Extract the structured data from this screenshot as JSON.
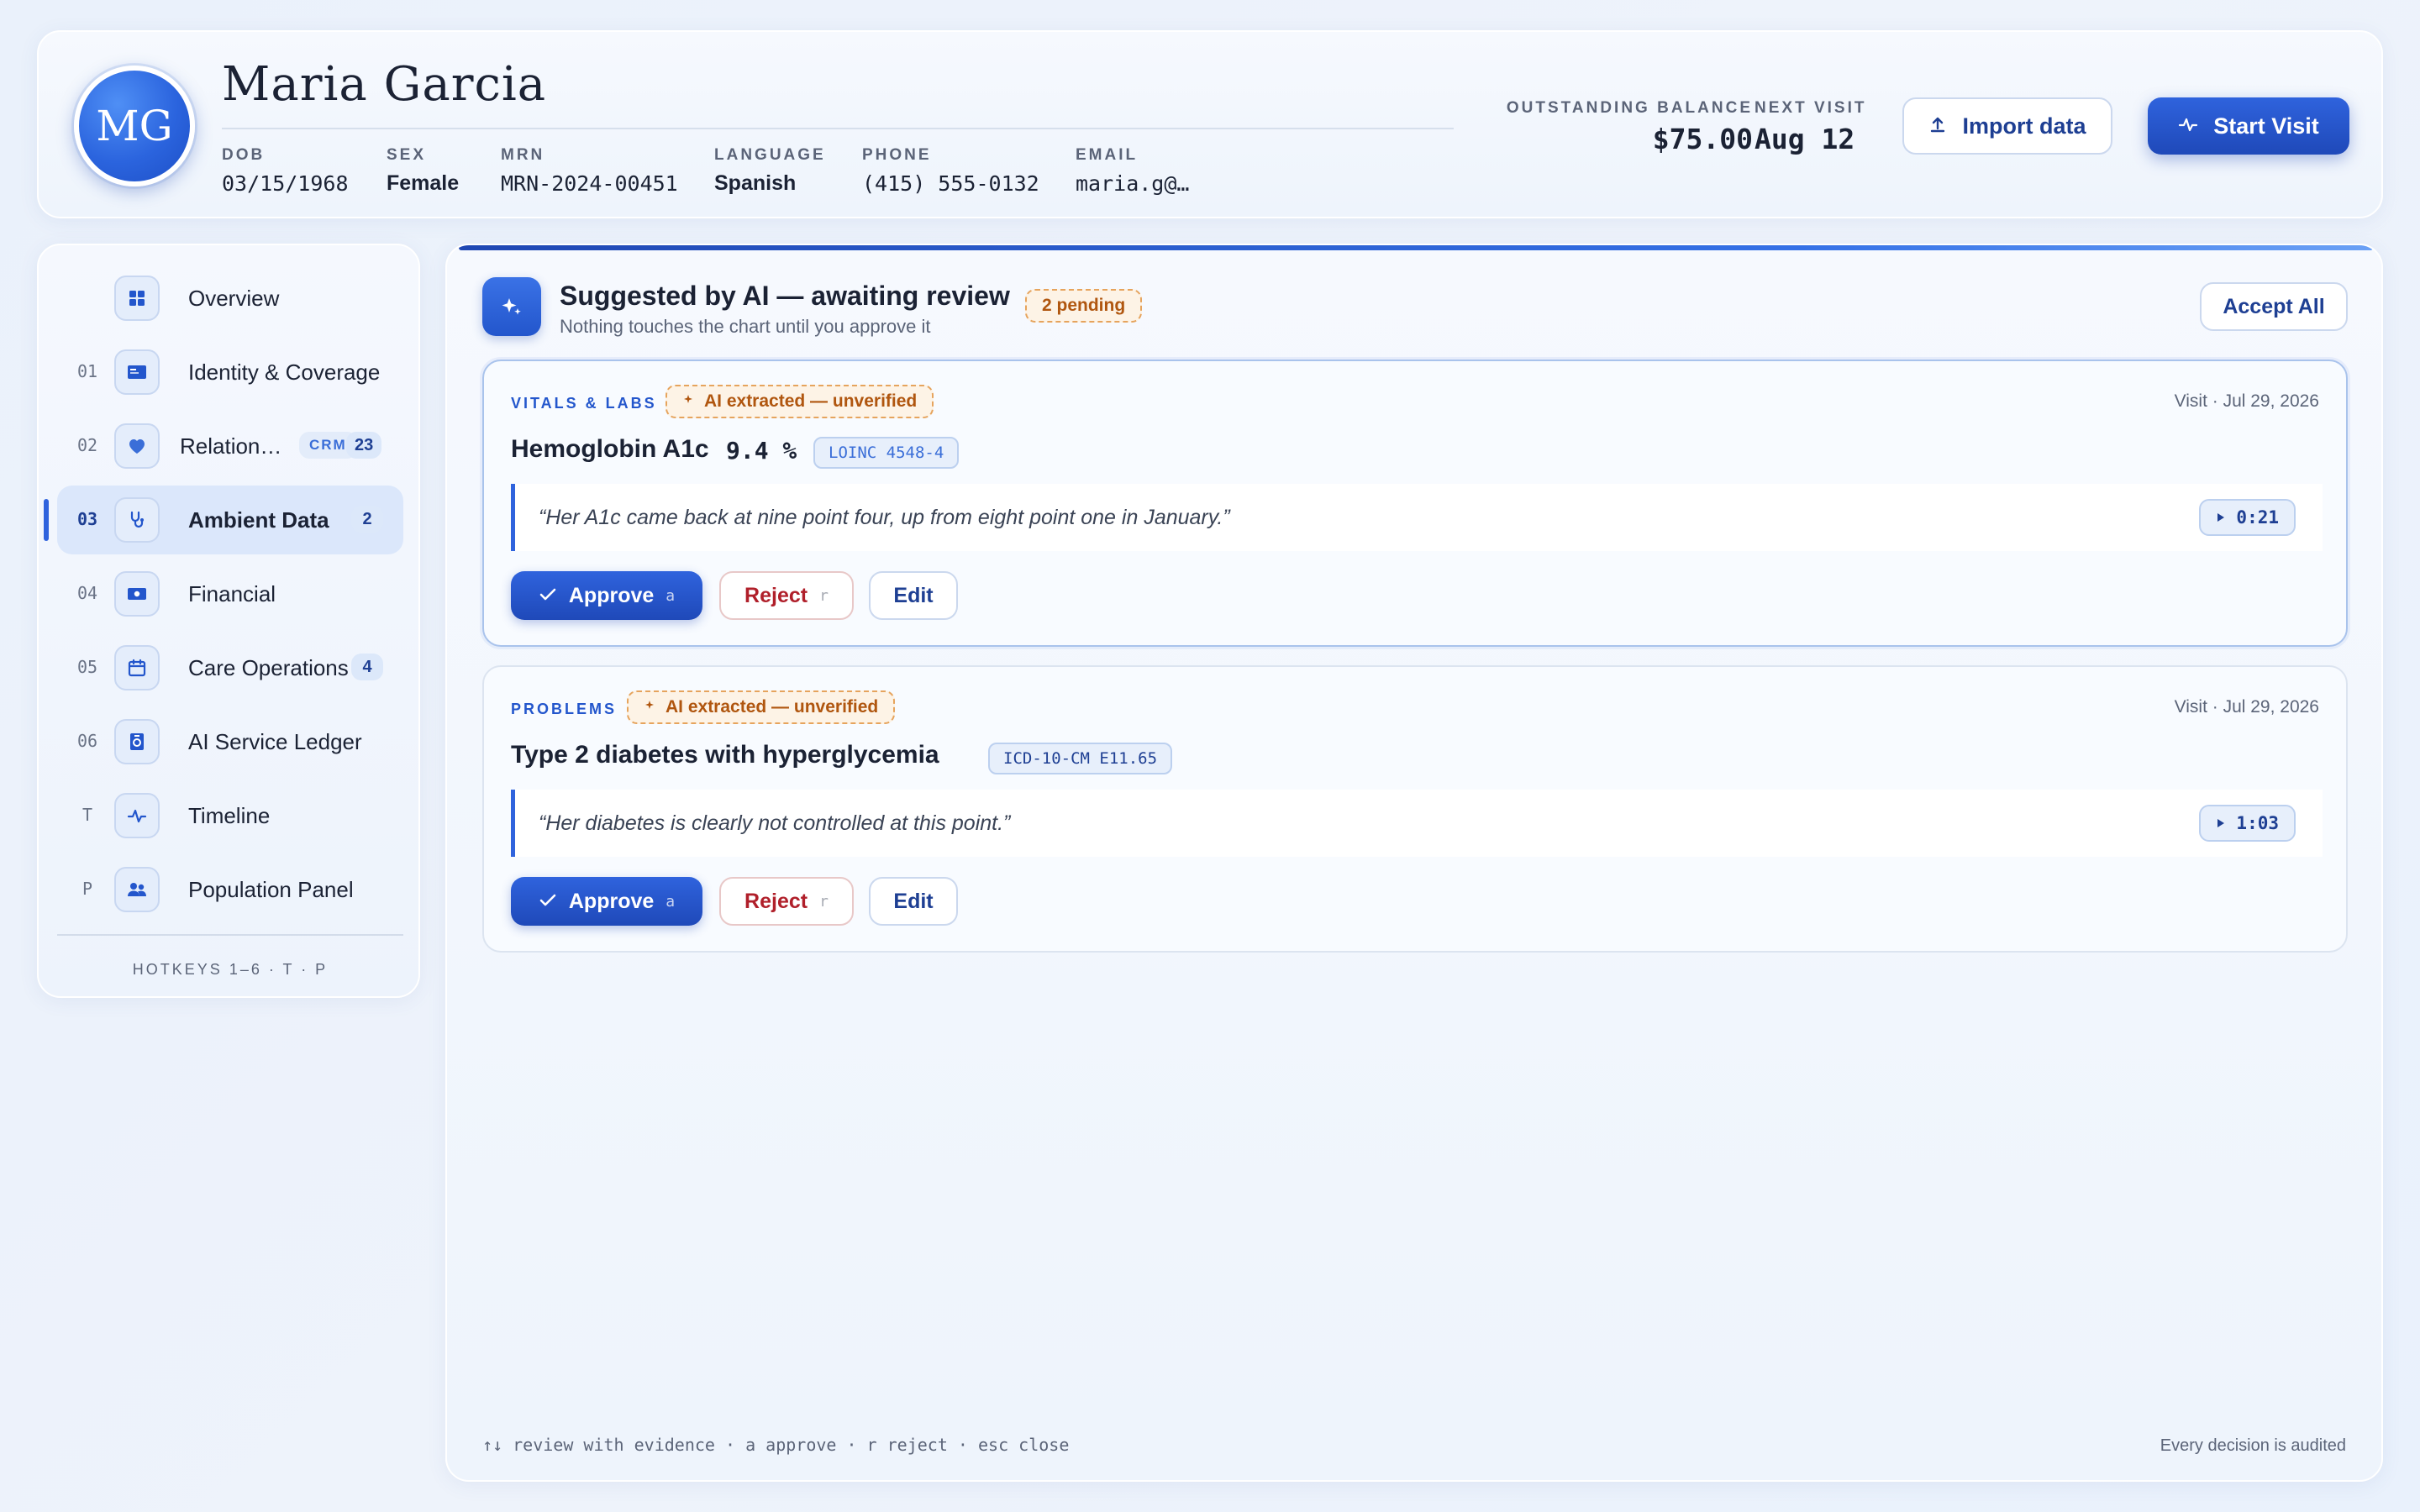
{
  "patient": {
    "initials": "MG",
    "name": "Maria Garcia",
    "demographics": [
      {
        "label": "DOB",
        "value": "03/15/1968"
      },
      {
        "label": "SEX",
        "value": "Female"
      },
      {
        "label": "MRN",
        "value": "MRN-2024-00451"
      },
      {
        "label": "LANGUAGE",
        "value": "Spanish"
      },
      {
        "label": "PHONE",
        "value": "(415) 555-0132"
      },
      {
        "label": "EMAIL",
        "value": "maria.g@…"
      }
    ]
  },
  "header": {
    "balance_label": "OUTSTANDING BALANCE",
    "balance_value": "$75.00",
    "next_visit_label": "NEXT VISIT",
    "next_visit_value": "Aug 12",
    "import_label": "Import data",
    "start_label": "Start Visit"
  },
  "sidebar": {
    "items": [
      {
        "num": "",
        "label": "Overview",
        "icon": "grid-icon"
      },
      {
        "num": "01",
        "label": "Identity & Coverage",
        "icon": "id-card-icon"
      },
      {
        "num": "02",
        "label": "Relation…",
        "icon": "heart-icon",
        "tag": "CRM",
        "count": "23"
      },
      {
        "num": "03",
        "label": "Ambient Data",
        "icon": "stethoscope-icon",
        "count": "2",
        "active": true
      },
      {
        "num": "04",
        "label": "Financial",
        "icon": "banknote-icon"
      },
      {
        "num": "05",
        "label": "Care Operations",
        "icon": "calendar-icon",
        "count": "4"
      },
      {
        "num": "06",
        "label": "AI Service Ledger",
        "icon": "ledger-icon"
      },
      {
        "num": "T",
        "label": "Timeline",
        "icon": "pulse-icon"
      },
      {
        "num": "P",
        "label": "Population Panel",
        "icon": "people-icon"
      }
    ],
    "hotkeys": "HOTKEYS 1–6 · T · P"
  },
  "review": {
    "title": "Suggested by AI — awaiting review",
    "subtitle": "Nothing touches the chart until you approve it",
    "pending": "2 pending",
    "accept_all": "Accept All",
    "approve_label": "Approve",
    "approve_key": "a",
    "reject_label": "Reject",
    "reject_key": "r",
    "edit_label": "Edit",
    "ai_tag": "AI extracted — unverified",
    "cards": [
      {
        "category": "VITALS & LABS",
        "date": "Visit · Jul 29, 2026",
        "title": "Hemoglobin A1c",
        "value": "9.4 %",
        "code": "LOINC 4548-4",
        "quote": "“Her A1c came back at nine point four, up from eight point one in January.”",
        "timestamp": "0:21"
      },
      {
        "category": "PROBLEMS",
        "date": "Visit · Jul 29, 2026",
        "title": "Type 2 diabetes with hyperglycemia",
        "value": "",
        "code": "ICD-10-CM E11.65",
        "quote": "“Her diabetes is clearly not controlled at this point.”",
        "timestamp": "1:03"
      }
    ],
    "footer_hint": "↑↓ review with evidence · a approve · r reject · esc close",
    "footer_audit": "Every decision is audited"
  },
  "colors": {
    "accent": "#2f63dd",
    "warning": "#b0560f",
    "danger": "#b01f2a"
  }
}
